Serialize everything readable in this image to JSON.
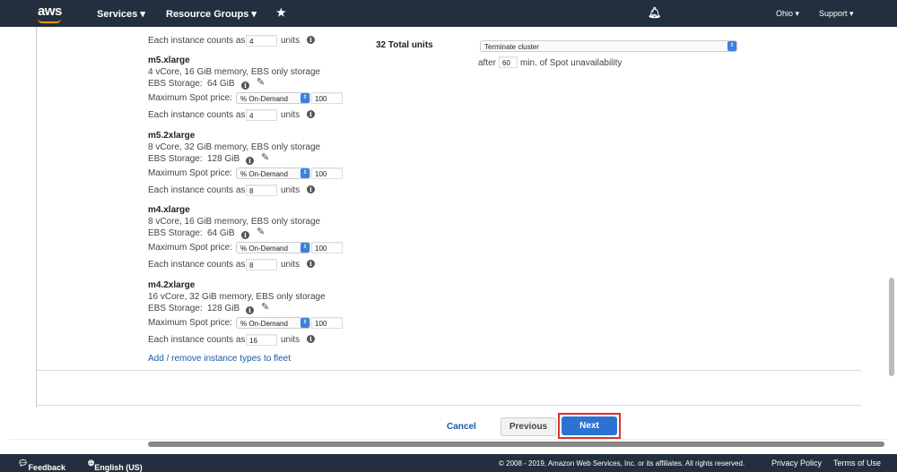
{
  "header": {
    "logo": "aws",
    "services": "Services",
    "resource_groups": "Resource Groups",
    "region": "Ohio",
    "support": "Support"
  },
  "top_row": {
    "label": "Each instance counts as",
    "value": "4",
    "units": "units"
  },
  "instances": [
    {
      "name": "m5.xlarge",
      "desc": "4 vCore, 16 GiB memory, EBS only storage",
      "ebs_label": "EBS Storage:",
      "ebs": "64 GiB",
      "price_label": "Maximum Spot price:",
      "price_type": "% On-Demand",
      "price": "100",
      "count_label": "Each instance counts as",
      "count": "4",
      "units": "units"
    },
    {
      "name": "m5.2xlarge",
      "desc": "8 vCore, 32 GiB memory, EBS only storage",
      "ebs_label": "EBS Storage:",
      "ebs": "128 GiB",
      "price_label": "Maximum Spot price:",
      "price_type": "% On-Demand",
      "price": "100",
      "count_label": "Each instance counts as",
      "count": "8",
      "units": "units"
    },
    {
      "name": "m4.xlarge",
      "desc": "8 vCore, 16 GiB memory, EBS only storage",
      "ebs_label": "EBS Storage:",
      "ebs": "64 GiB",
      "price_label": "Maximum Spot price:",
      "price_type": "% On-Demand",
      "price": "100",
      "count_label": "Each instance counts as",
      "count": "8",
      "units": "units"
    },
    {
      "name": "m4.2xlarge",
      "desc": "16 vCore, 32 GiB memory, EBS only storage",
      "ebs_label": "EBS Storage:",
      "ebs": "128 GiB",
      "price_label": "Maximum Spot price:",
      "price_type": "% On-Demand",
      "price": "100",
      "count_label": "Each instance counts as",
      "count": "16",
      "units": "units"
    }
  ],
  "add_remove_link": "Add / remove instance types to fleet",
  "summary": {
    "total": "32 Total units",
    "action": "Terminate cluster",
    "after": "after",
    "minutes": "60",
    "after_suffix": "min. of Spot unavailability"
  },
  "buttons": {
    "cancel": "Cancel",
    "previous": "Previous",
    "next": "Next"
  },
  "footer": {
    "feedback": "Feedback",
    "language": "English (US)",
    "copyright": "© 2008 - 2019, Amazon Web Services, Inc. or its affiliates. All rights reserved.",
    "privacy": "Privacy Policy",
    "terms": "Terms of Use"
  }
}
